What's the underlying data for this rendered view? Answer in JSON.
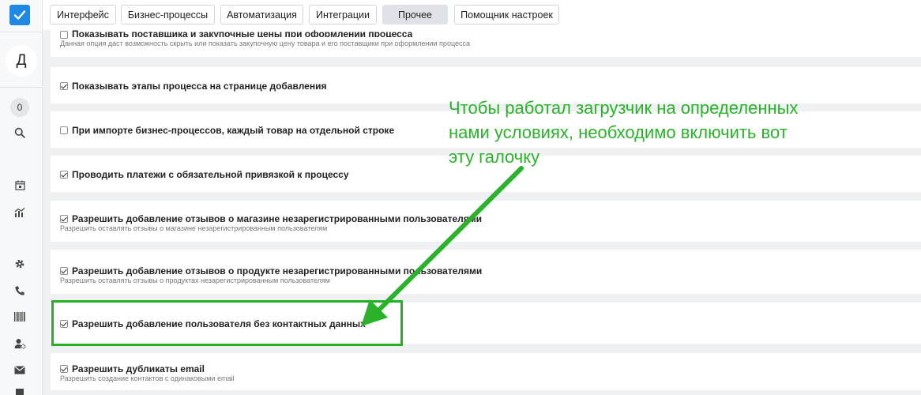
{
  "sidebar": {
    "avatar_letter": "Д",
    "counter": "0",
    "icons": [
      "search-icon",
      "calendar-icon",
      "chart-icon",
      "gear-icon",
      "phone-icon",
      "barcode-icon",
      "user-settings-icon",
      "mail-icon"
    ]
  },
  "tabs": [
    {
      "label": "Интерфейс",
      "active": false
    },
    {
      "label": "Бизнес-процессы",
      "active": false
    },
    {
      "label": "Автоматизация",
      "active": false
    },
    {
      "label": "Интеграции",
      "active": false
    },
    {
      "label": "Прочее",
      "active": true
    },
    {
      "label": "Помощник настроек",
      "active": false
    }
  ],
  "settings": [
    {
      "label": "Показывать поставщика и закупочные цены при оформлении процесса",
      "desc": "Данная опция даст возможность скрыть или показать закупочную цену товара и его поставщики при оформлении процесса",
      "checked": false
    },
    {
      "label": "Показывать этапы процесса на странице добавления",
      "desc": "",
      "checked": true
    },
    {
      "label": "При импорте бизнес-процессов, каждый товар на отдельной строке",
      "desc": "",
      "checked": false
    },
    {
      "label": "Проводить платежи с обязательной привязкой к процессу",
      "desc": "",
      "checked": true
    },
    {
      "label": "Разрешить добавление отзывов о магазине незарегистрированными пользователями",
      "desc": "Разрешить оставлять отзывы о магазине незарегистрированным пользователям",
      "checked": true
    },
    {
      "label": "Разрешить добавление отзывов о продукте незарегистрированными пользователями",
      "desc": "Разрешить оставлять отзывы о продуктах незарегистрированным пользователям",
      "checked": true
    },
    {
      "label": "Разрешить добавление пользователя без контактных данных",
      "desc": "",
      "checked": true
    },
    {
      "label": "Разрешить дубликаты email",
      "desc": "Разрешить создание контактов с одинаковыми email",
      "checked": true
    }
  ],
  "annotation": {
    "line1": "Чтобы работал загрузчик на определенных",
    "line2": "нами условиях, необходимо включить вот",
    "line3": "эту галочку"
  },
  "colors": {
    "accent": "#1e88e5",
    "annotation": "#2bb22b",
    "highlight_border": "#23b123"
  }
}
